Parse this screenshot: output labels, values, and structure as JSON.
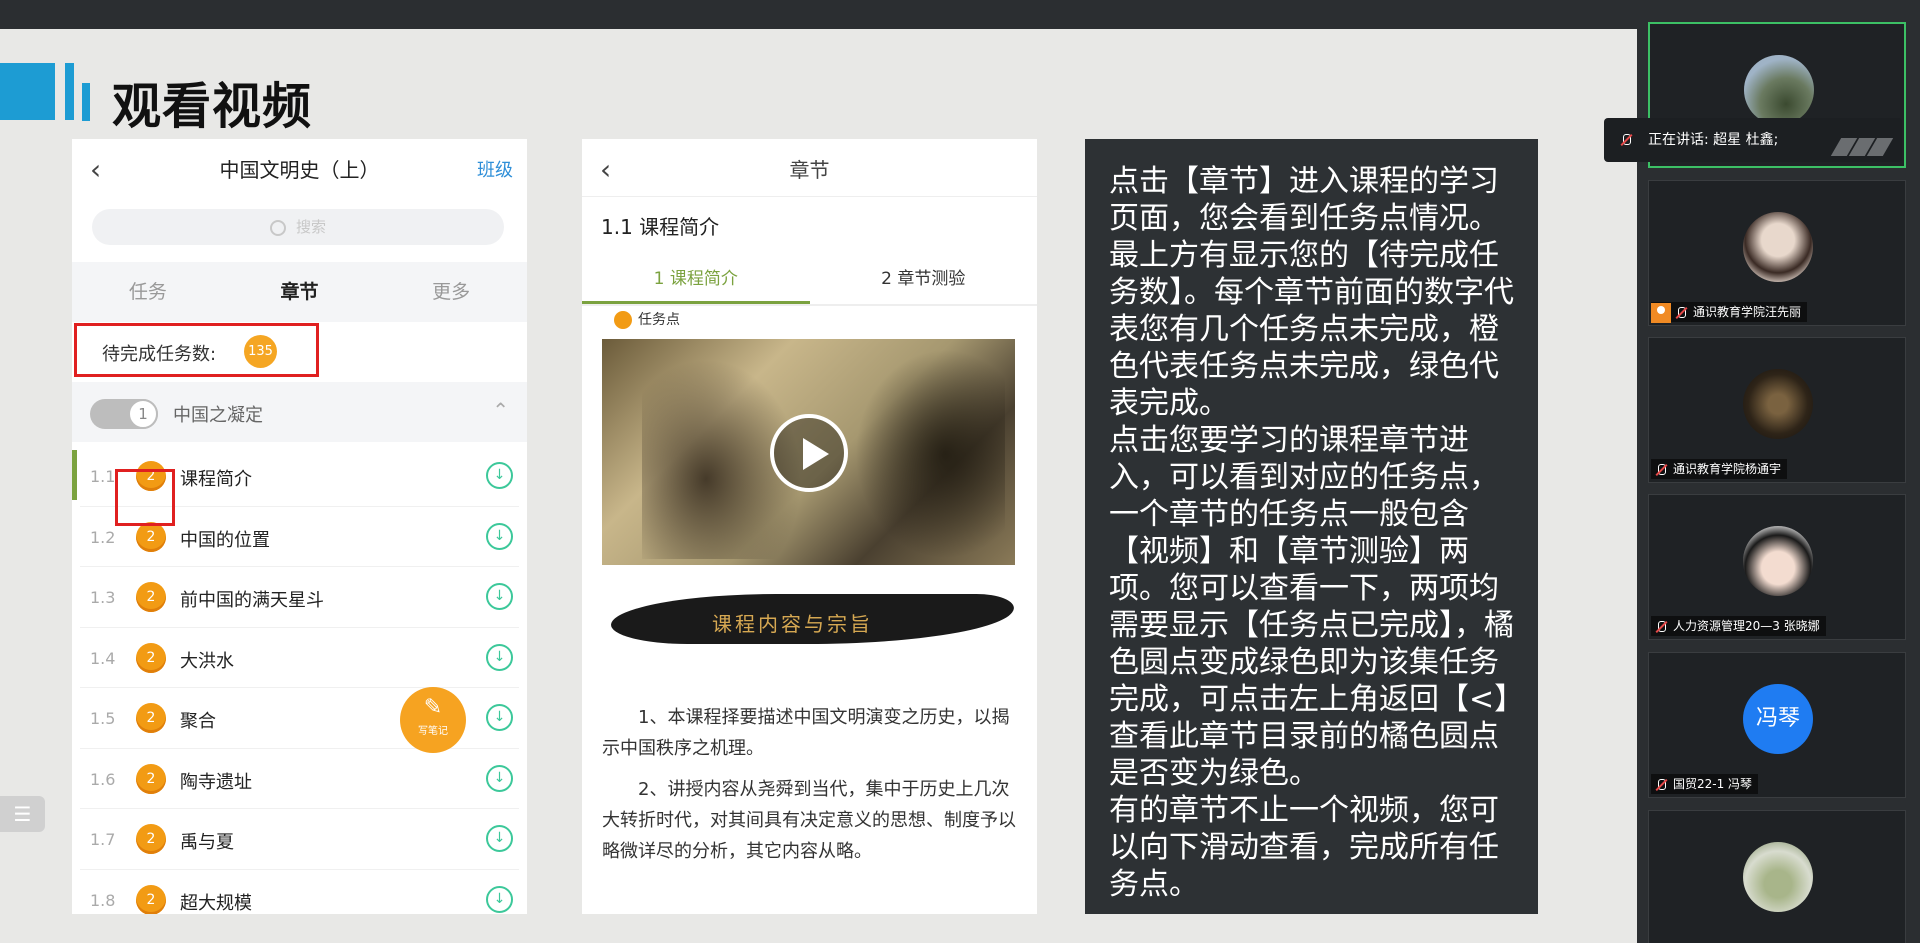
{
  "slide": {
    "title": "观看视频"
  },
  "phone1": {
    "title": "中国文明史（上）",
    "class_link": "班级",
    "search_placeholder": "搜索",
    "tabs": [
      "任务",
      "章节",
      "更多"
    ],
    "pending_label": "待完成任务数:",
    "pending_count": "135",
    "chapter": {
      "index": "1",
      "title": "中国之凝定"
    },
    "items": [
      {
        "num": "1.1",
        "badge": "2",
        "name": "课程简介"
      },
      {
        "num": "1.2",
        "badge": "2",
        "name": "中国的位置"
      },
      {
        "num": "1.3",
        "badge": "2",
        "name": "前中国的满天星斗"
      },
      {
        "num": "1.4",
        "badge": "2",
        "name": "大洪水"
      },
      {
        "num": "1.5",
        "badge": "2",
        "name": "聚合"
      },
      {
        "num": "1.6",
        "badge": "2",
        "name": "陶寺遗址"
      },
      {
        "num": "1.7",
        "badge": "2",
        "name": "禹与夏"
      },
      {
        "num": "1.8",
        "badge": "2",
        "name": "超大规模"
      }
    ]
  },
  "phone2": {
    "title": "章节",
    "section": "1.1 课程简介",
    "tabs": [
      "1 课程简介",
      "2 章节测验"
    ],
    "task_point": "任务点",
    "banner_text": "课程内容与宗旨",
    "paragraphs": [
      "1、本课程择要描述中国文明演变之历史，以揭示中国秩序之机理。",
      "2、讲授内容从尧舜到当代，集中于历史上几次大转折时代，对其间具有决定意义的思想、制度予以略微详尽的分析，其它内容从略。"
    ],
    "note_button": "写笔记"
  },
  "instructions": {
    "text": "点击【章节】进入课程的学习页面，您会看到任务点情况。最上方有显示您的【待完成任务数】。每个章节前面的数字代表您有几个任务点未完成，橙色代表任务点未完成，绿色代表完成。\n点击您要学习的课程章节进入，可以看到对应的任务点，一个章节的任务点一般包含【视频】和【章节测验】两项。您可以查看一下，两项均需要显示【任务点已完成】，橘色圆点变成绿色即为该集任务完成，可点击左上角返回【<】查看此章节目录前的橘色圆点是否变为绿色。\n有的章节不止一个视频，您可以向下滑动查看，完成所有任务点。"
  },
  "meeting": {
    "speaking": "正在讲话: 超星 杜鑫;",
    "participants": [
      {
        "name": "",
        "avatar": "tree"
      },
      {
        "name": "通识教育学院汪先丽",
        "avatar": "girl",
        "host": true
      },
      {
        "name": "通识教育学院杨通宇",
        "avatar": "dark"
      },
      {
        "name": "人力资源管理20—3  张晓娜",
        "avatar": "anime"
      },
      {
        "name": "国贸22-1 冯琴",
        "avatar": "blue",
        "initials": "冯琴"
      },
      {
        "name": "",
        "avatar": "field"
      }
    ]
  },
  "colors": {
    "accent_blue": "#1d9cd3",
    "highlight_red": "#e02020",
    "task_orange": "#f29b14",
    "active_green": "#7ba23f",
    "download_green": "#3cc89a"
  }
}
